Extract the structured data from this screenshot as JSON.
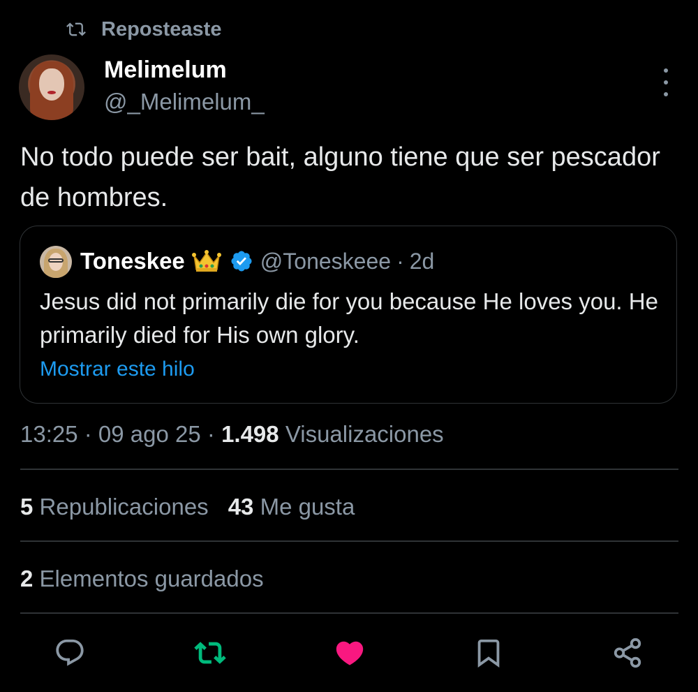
{
  "repost_banner": {
    "icon": "repost-icon",
    "label": "Reposteaste"
  },
  "author": {
    "display_name": "Melimelum",
    "handle": "@_Melimelum_"
  },
  "tweet": {
    "text": "No todo puede ser bait, alguno tiene que ser pescador de hombres."
  },
  "quoted_tweet": {
    "display_name": "Toneskee",
    "emoji": "crown-emoji",
    "verified_icon": "verified-badge-icon",
    "handle": "@Toneskeee",
    "separator": "·",
    "time": "2d",
    "text": "Jesus did not primarily die for you because He loves you. He primarily died for His own glory.",
    "show_thread_label": "Mostrar este hilo"
  },
  "meta": {
    "time": "13:25",
    "sep1": " · ",
    "date": "09 ago 25",
    "sep2": " · ",
    "views_count": "1.498",
    "views_label": " Visualizaciones"
  },
  "stats": {
    "reposts_count": "5",
    "reposts_label": " Republicaciones",
    "likes_count": "43",
    "likes_label": " Me gusta",
    "bookmarks_count": "2",
    "bookmarks_label": " Elementos guardados"
  },
  "actions": [
    {
      "icon": "reply-icon"
    },
    {
      "icon": "repost-icon",
      "color": "#00ba7c"
    },
    {
      "icon": "like-icon",
      "color": "#f91880"
    },
    {
      "icon": "bookmark-icon"
    },
    {
      "icon": "share-icon"
    }
  ],
  "colors": {
    "background": "#000000",
    "primary_text": "#e7e9ea",
    "secondary_text": "#8b98a5",
    "link": "#1d9bf0",
    "repost_active": "#00ba7c",
    "like_active": "#f91880",
    "verified": "#1d9bf0",
    "divider": "#2f3336"
  }
}
